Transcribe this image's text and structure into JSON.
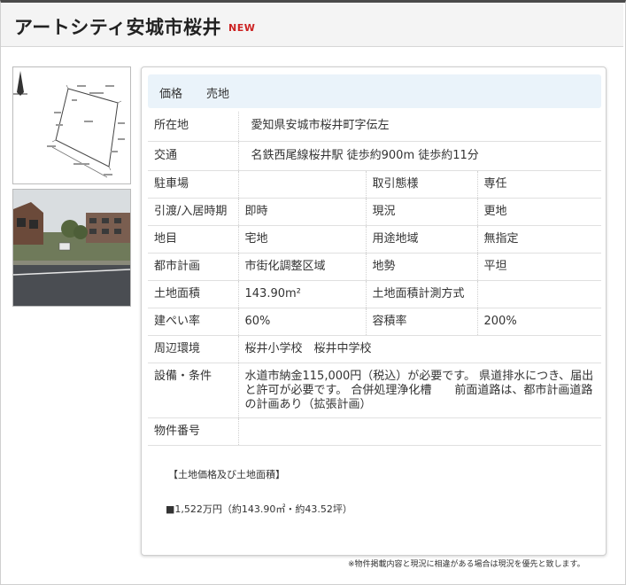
{
  "property": {
    "title": "アートシティ安城市桜井",
    "badge": "NEW"
  },
  "price": {
    "label": "価格",
    "value": "売地"
  },
  "details": {
    "location_label": "所在地",
    "location_value": "愛知県安城市桜井町字伝左",
    "access_label": "交通",
    "access_value": "名鉄西尾線桜井駅 徒歩約900m 徒歩約11分",
    "parking_label": "駐車場",
    "parking_value": "",
    "trade_label": "取引態様",
    "trade_value": "専任",
    "handover_label": "引渡/入居時期",
    "handover_value": "即時",
    "status_label": "現況",
    "status_value": "更地",
    "landcat_label": "地目",
    "landcat_value": "宅地",
    "zoning_label": "用途地域",
    "zoning_value": "無指定",
    "cityplan_label": "都市計画",
    "cityplan_value": "市街化調整区域",
    "terrain_label": "地勢",
    "terrain_value": "平坦",
    "area_label": "土地面積",
    "area_value": "143.90m²",
    "measure_label": "土地面積計測方式",
    "measure_value": "",
    "coverage_label": "建ぺい率",
    "coverage_value": "60%",
    "far_label": "容積率",
    "far_value": "200%",
    "env_label": "周辺環境",
    "env_value": "桜井小学校　桜井中学校",
    "equip_label": "設備・条件",
    "equip_value": "水道市納金115,000円（税込）が必要です。 県道排水につき、届出と許可が必要です。 合併処理浄化槽　　前面道路は、都市計画道路の計画あり（拡張計画）",
    "propno_label": "物件番号",
    "propno_value": ""
  },
  "land_info": {
    "heading": "【土地価格及び土地面積】",
    "value": "■1,522万円（約143.90㎡・約43.52坪）"
  },
  "footnote": "※物件掲載内容と現況に相違がある場合は現況を優先と致します。"
}
